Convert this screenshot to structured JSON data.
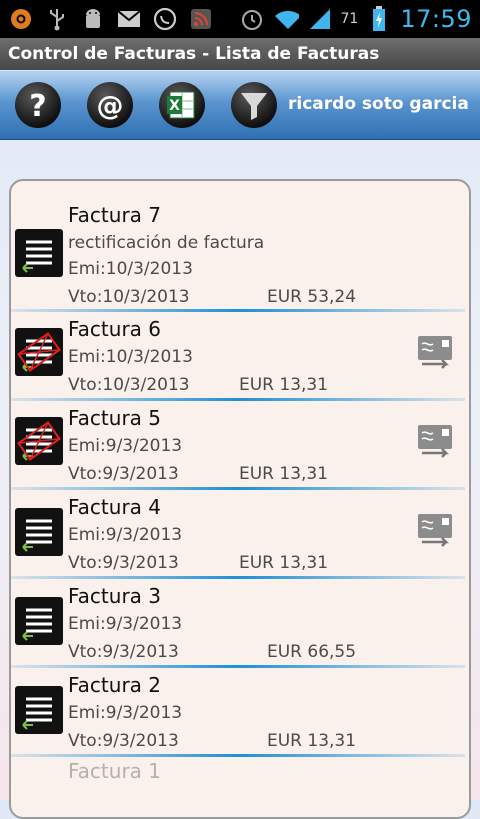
{
  "status": {
    "battery": "71",
    "time": "17:59",
    "icons": [
      "ubuntu-one-icon",
      "usb-icon",
      "android-debug-icon",
      "gmail-icon",
      "whatsapp-icon",
      "rss-icon",
      "alarm-icon",
      "wifi-icon",
      "signal-icon",
      "battery-charging-icon"
    ]
  },
  "app": {
    "title": "Control de Facturas - Lista de Facturas"
  },
  "toolbar": {
    "buttons": [
      "help-icon",
      "email-icon",
      "excel-icon",
      "filter-icon"
    ],
    "user": "ricardo soto garcia"
  },
  "invoices": [
    {
      "title": "Factura 7",
      "note": "rectificación de factura",
      "emi": "Emi:10/3/2013",
      "vto": "Vto:10/3/2013",
      "amount": "EUR 53,24",
      "icon": "invoice-icon",
      "action": ""
    },
    {
      "title": "Factura 6",
      "emi": "Emi:10/3/2013",
      "vto": "Vto:10/3/2013",
      "amount": "EUR 13,31",
      "icon": "invoice-cancelled-icon",
      "action": "transfer-icon"
    },
    {
      "title": "Factura 5",
      "emi": "Emi:9/3/2013",
      "vto": "Vto:9/3/2013",
      "amount": "EUR 13,31",
      "icon": "invoice-cancelled-icon",
      "action": "transfer-icon"
    },
    {
      "title": "Factura 4",
      "emi": "Emi:9/3/2013",
      "vto": "Vto:9/3/2013",
      "amount": "EUR 13,31",
      "icon": "invoice-icon",
      "action": "transfer-icon"
    },
    {
      "title": "Factura 3",
      "emi": "Emi:9/3/2013",
      "vto": "Vto:9/3/2013",
      "amount": "EUR 66,55",
      "icon": "invoice-icon",
      "action": ""
    },
    {
      "title": "Factura 2",
      "emi": "Emi:9/3/2013",
      "vto": "Vto:9/3/2013",
      "amount": "EUR 13,31",
      "icon": "invoice-icon",
      "action": ""
    }
  ],
  "partial_item": "Factura 1",
  "colors": {
    "accent": "#1f8fd6",
    "toolbar": "#3b7fc2",
    "time": "#3fb6ee"
  }
}
